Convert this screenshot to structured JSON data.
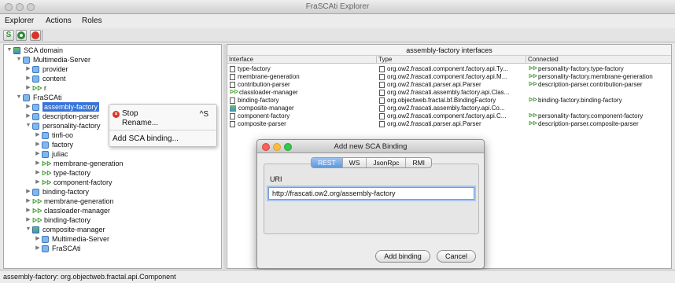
{
  "window": {
    "title": "FraSCAti Explorer"
  },
  "menu": {
    "items": [
      "Explorer",
      "Actions",
      "Roles"
    ]
  },
  "toolbar": {
    "buttons": [
      {
        "icon": "refresh-icon"
      },
      {
        "icon": "settings-icon"
      },
      {
        "icon": "close-icon"
      }
    ]
  },
  "tree": {
    "items": [
      {
        "label": "SCA domain"
      },
      {
        "label": "Multimedia-Server"
      },
      {
        "label": "provider"
      },
      {
        "label": "content"
      },
      {
        "label": "r"
      },
      {
        "label": "FraSCAti"
      },
      {
        "label": "assembly-factory"
      },
      {
        "label": "description-parser"
      },
      {
        "label": "personality-factory"
      },
      {
        "label": "tinfi-oo"
      },
      {
        "label": "factory"
      },
      {
        "label": "juliac"
      },
      {
        "label": "membrane-generation"
      },
      {
        "label": "type-factory"
      },
      {
        "label": "component-factory"
      },
      {
        "label": "binding-factory"
      },
      {
        "label": "membrane-generation"
      },
      {
        "label": "classloader-manager"
      },
      {
        "label": "binding-factory"
      },
      {
        "label": "composite-manager"
      },
      {
        "label": "Multimedia-Server"
      },
      {
        "label": "FraSCAti"
      }
    ]
  },
  "context_menu": {
    "stop": "Stop",
    "stop_shortcut": "^S",
    "rename": "Rename...",
    "add_binding": "Add SCA binding..."
  },
  "interfaces": {
    "title": "assembly-factory interfaces",
    "columns": [
      "Interface",
      "Type",
      "Connected"
    ],
    "rows": [
      {
        "interface": "type-factory",
        "type": "org.ow2.frascati.component.factory.api.Ty...",
        "connected": "personality-factory.type-factory"
      },
      {
        "interface": "membrane-generation",
        "type": "org.ow2.frascati.component.factory.api.M...",
        "connected": "personality-factory.membrane-generation"
      },
      {
        "interface": "contribution-parser",
        "type": "org.ow2.frascati.parser.api.Parser",
        "connected": "description-parser.contribution-parser"
      },
      {
        "interface": "classloader-manager",
        "type": "org.ow2.frascati.assembly.factory.api.Clas...",
        "connected": ""
      },
      {
        "interface": "binding-factory",
        "type": "org.objectweb.fractal.bf.BindingFactory",
        "connected": "binding-factory.binding-factory"
      },
      {
        "interface": "composite-manager",
        "type": "org.ow2.frascati.assembly.factory.api.Co...",
        "connected": ""
      },
      {
        "interface": "component-factory",
        "type": "org.ow2.frascati.component.factory.api.C...",
        "connected": "personality-factory.component-factory"
      },
      {
        "interface": "composite-parser",
        "type": "org.ow2.frascati.parser.api.Parser",
        "connected": "description-parser.composite-parser"
      }
    ]
  },
  "dialog": {
    "title": "Add new SCA Binding",
    "tabs": [
      "REST",
      "WS",
      "JsonRpc",
      "RMI"
    ],
    "active_tab": "REST",
    "uri_label": "URI",
    "uri_value": "http://frascati.ow2.org/assembly-factory",
    "add_button": "Add binding",
    "cancel_button": "Cancel"
  },
  "status": {
    "text": "assembly-factory: org.objectweb.fractal.api.Component"
  },
  "colors": {
    "selection": "#3875d7",
    "close": "#fc615d",
    "minimize": "#fdbc40",
    "zoom": "#34c84a",
    "binding": "#3b9a2b"
  }
}
